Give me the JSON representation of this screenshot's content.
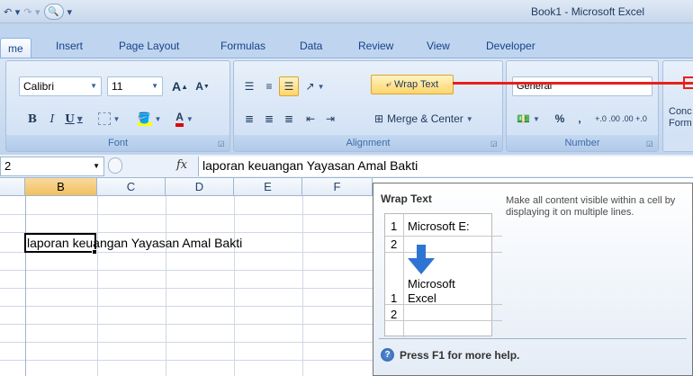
{
  "window": {
    "title": "Book1 - Microsoft Excel"
  },
  "tabs": [
    {
      "label": "me",
      "active": true
    },
    {
      "label": "Insert"
    },
    {
      "label": "Page Layout"
    },
    {
      "label": "Formulas"
    },
    {
      "label": "Data"
    },
    {
      "label": "Review"
    },
    {
      "label": "View"
    },
    {
      "label": "Developer"
    }
  ],
  "ribbon": {
    "font": {
      "name": "Calibri",
      "size": "11",
      "grow_label": "A",
      "shrink_label": "A",
      "bold": "B",
      "italic": "I",
      "underline": "U",
      "font_color_label": "A",
      "group_label": "Font"
    },
    "alignment": {
      "wrap_text": "Wrap Text",
      "merge_center": "Merge & Center",
      "group_label": "Alignment"
    },
    "number": {
      "format": "General",
      "percent": "%",
      "comma": ",",
      "inc_decimal": "+.0 .00",
      "dec_decimal": ".00 +.0",
      "group_label": "Number"
    },
    "styles": {
      "conditional_partial": "Conc Form"
    }
  },
  "formula_bar": {
    "name_box": "2",
    "fx": "fx",
    "content": "laporan keuangan Yayasan Amal Bakti"
  },
  "grid": {
    "columns": [
      "B",
      "C",
      "D",
      "E",
      "F"
    ],
    "selected_column": "B",
    "cell_text": "laporan keuangan Yayasan Amal Bakti"
  },
  "tooltip": {
    "title": "Wrap Text",
    "description": "Make all content visible within a cell by displaying it on multiple lines.",
    "sample_before": {
      "row1_num": "1",
      "row1_text": "Microsoft E:",
      "row2_num": "2"
    },
    "sample_after": {
      "line1": "Microsoft",
      "row1_num": "1",
      "row1_text": "Excel",
      "row2_num": "2"
    },
    "help": "Press F1 for more help."
  },
  "colors": {
    "accent_red": "#e8201a",
    "ribbon_blue": "#bfd4ee",
    "selected_header": "#f1c15f"
  }
}
